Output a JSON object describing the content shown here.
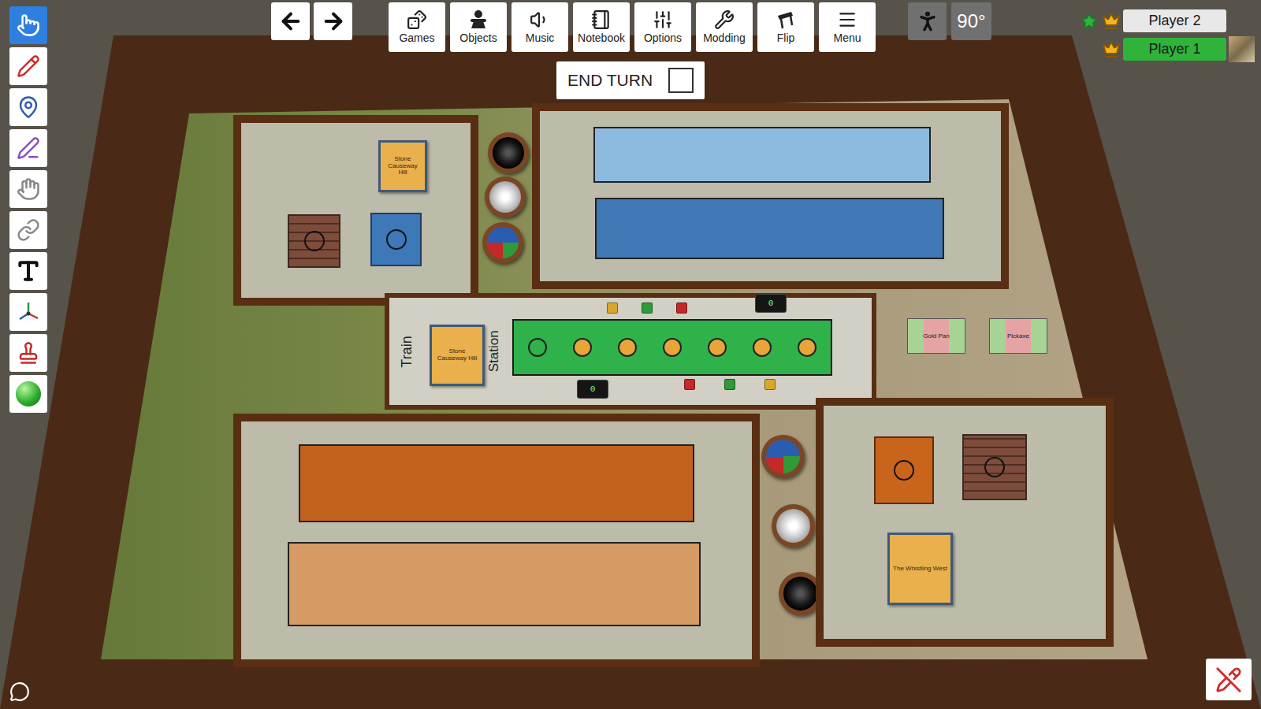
{
  "tools": [
    {
      "kind": "pointer",
      "selected": true
    },
    {
      "kind": "pencil",
      "selected": false
    },
    {
      "kind": "pin",
      "selected": false
    },
    {
      "kind": "line",
      "selected": false
    },
    {
      "kind": "gizmo",
      "selected": false
    },
    {
      "kind": "joint",
      "selected": false
    },
    {
      "kind": "text",
      "selected": false
    },
    {
      "kind": "axes",
      "selected": false
    },
    {
      "kind": "stamp",
      "selected": false
    },
    {
      "kind": "ball",
      "selected": false
    }
  ],
  "nav": [
    {
      "kind": "back"
    },
    {
      "kind": "forward"
    }
  ],
  "menu": [
    {
      "label": "Games",
      "kind": "games"
    },
    {
      "label": "Objects",
      "kind": "objects"
    },
    {
      "label": "Music",
      "kind": "music"
    },
    {
      "label": "Notebook",
      "kind": "notebook"
    },
    {
      "label": "Options",
      "kind": "options"
    },
    {
      "label": "Modding",
      "kind": "modding"
    },
    {
      "label": "Flip",
      "kind": "flip"
    },
    {
      "label": "Menu",
      "kind": "menu"
    }
  ],
  "rotation": "90°",
  "end_turn": {
    "label": "END TURN",
    "checked": false
  },
  "players": [
    {
      "name": "Player 2",
      "color": "#e8e8e8",
      "star": true,
      "crown": true,
      "avatar": false
    },
    {
      "name": "Player 1",
      "color": "#2fb33a",
      "star": false,
      "crown": true,
      "avatar": true
    }
  ],
  "board": {
    "mat_top": {
      "card": "Stone Causeway Hill",
      "slots": [
        {
          "kind": "brick"
        },
        {
          "kind": "blue"
        }
      ]
    },
    "mat_bottom": {
      "card": "The Whistling West",
      "slots": [
        {
          "kind": "orange"
        },
        {
          "kind": "brick"
        }
      ]
    },
    "bars_top": [
      {
        "color": "#8dbbdf"
      },
      {
        "color": "#3f78b5"
      }
    ],
    "bars_bottom": [
      {
        "color": "#c2621c"
      },
      {
        "color": "#d69a64"
      }
    ],
    "bowls_top": [
      {
        "kind": "black"
      },
      {
        "kind": "white"
      },
      {
        "kind": "mixed"
      }
    ],
    "bowls_bottom": [
      {
        "kind": "mixed"
      },
      {
        "kind": "white"
      },
      {
        "kind": "black"
      }
    ],
    "station": {
      "train_label": "Train",
      "station_label": "Station",
      "card": "Stone Causeway Hill",
      "track": [
        {
          "filled": false
        },
        {
          "filled": true
        },
        {
          "filled": true
        },
        {
          "filled": true
        },
        {
          "filled": true
        },
        {
          "filled": true
        },
        {
          "filled": true
        }
      ],
      "cubes_top": [
        {
          "color": "#d9a82a"
        },
        {
          "color": "#2e9a3a"
        },
        {
          "color": "#c6282a"
        }
      ],
      "cubes_bottom": [
        {
          "color": "#c6282a"
        },
        {
          "color": "#2e9a3a"
        },
        {
          "color": "#d9a82a"
        }
      ],
      "counters": [
        "0",
        "0"
      ]
    },
    "side_cards": [
      {
        "label": "Gold Pan"
      },
      {
        "label": "Pickaxe"
      }
    ]
  }
}
